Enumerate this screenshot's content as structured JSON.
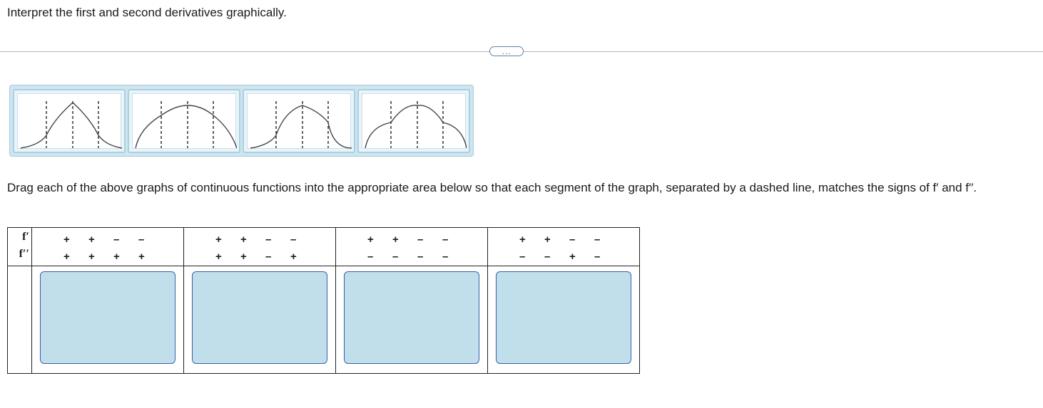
{
  "question": {
    "title": "Interpret the first and second derivatives graphically."
  },
  "toolbar": {
    "more_label": "..."
  },
  "tray": {
    "tiles": [
      {
        "name": "graph-tile-1"
      },
      {
        "name": "graph-tile-2"
      },
      {
        "name": "graph-tile-3"
      },
      {
        "name": "graph-tile-4"
      }
    ]
  },
  "instructions": "Drag each of the above graphs of continuous functions into the appropriate area below so that each segment of the graph, separated by a dashed line, matches the signs of f′ and f′′.",
  "table": {
    "row_labels": {
      "first": "f′",
      "second": "f′′"
    },
    "columns": [
      {
        "f1": [
          "+",
          "+",
          "–",
          "–"
        ],
        "f2": [
          "+",
          "+",
          "+",
          "+"
        ]
      },
      {
        "f1": [
          "+",
          "+",
          "–",
          "–"
        ],
        "f2": [
          "+",
          "+",
          "–",
          "+"
        ]
      },
      {
        "f1": [
          "+",
          "+",
          "–",
          "–"
        ],
        "f2": [
          "–",
          "–",
          "–",
          "–"
        ]
      },
      {
        "f1": [
          "+",
          "+",
          "–",
          "–"
        ],
        "f2": [
          "–",
          "–",
          "+",
          "–"
        ]
      }
    ]
  }
}
